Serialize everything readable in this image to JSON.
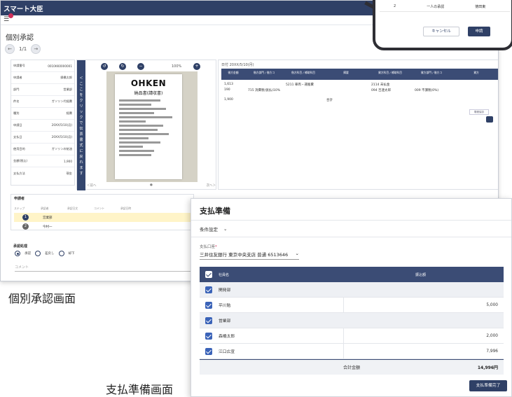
{
  "approval": {
    "app_title": "スマート大臣",
    "menu_icon": "menu-icon",
    "page_title": "個別承認",
    "pager": {
      "count": "1/1"
    },
    "info_rows": [
      {
        "label": "申請番号",
        "value": "0010KK0000001"
      },
      {
        "label": "申請者",
        "value": "操橋太郎"
      },
      {
        "label": "部門",
        "value": "営業部"
      },
      {
        "label": "件名",
        "value": "ガソリン代経費"
      },
      {
        "label": "種別",
        "value": "経費"
      },
      {
        "label": "申請日",
        "value": "20XX/5/10(月)"
      },
      {
        "label": "支払日",
        "value": "20XX/5/10(月)"
      },
      {
        "label": "使用目的",
        "value": "ガソリンの給油"
      },
      {
        "label": "金額(税込)",
        "value": "1,900"
      },
      {
        "label": "支払方法",
        "value": "現金"
      }
    ],
    "viewer": {
      "side_text": "ここをクリックで伝票書式に戻れます",
      "zoom": "100%",
      "receipt_logo": "OHKEN",
      "receipt_title": "納品書(請収書)",
      "prev": "＜前へ",
      "next": "次へ＞"
    },
    "detail": {
      "date": "日付 20XX/5/10(月)",
      "headers": [
        "借方金額",
        "借方部門 / 借方コ",
        "借方科目 / 補助科目",
        "摘要",
        "貸方科目 / 補助科目",
        "貸方部門 / 借方コ",
        "貸方"
      ],
      "rows": [
        {
          "a": "1,613",
          "b": "",
          "c": "5211 車両・運搬費",
          "d": "",
          "e": "2114 未払金",
          "f": ""
        },
        {
          "a": "190",
          "b": "715 消費税(仮払)10%",
          "c": "",
          "d": "",
          "e": "094 吉連太郎",
          "f": "009 不課税(0%)"
        },
        {
          "a": "1,900",
          "b": "",
          "c": "",
          "d": "合計",
          "e": "",
          "f": ""
        }
      ],
      "small_button": "電帳保存"
    },
    "flow": {
      "title": "申請者",
      "headers": [
        "ステップ",
        "承認者",
        "承認日文",
        "コメント",
        "承認日時"
      ],
      "steps": [
        {
          "num": "1",
          "name": "営業部"
        },
        {
          "num": "2",
          "name": "今村一"
        }
      ]
    },
    "decision": {
      "title": "承認処理",
      "options": [
        "承認",
        "差戻し",
        "却下"
      ],
      "selected": 0,
      "comment_placeholder": "コメント"
    },
    "caption": "個別承認画面"
  },
  "phone": {
    "row": {
      "num": "2",
      "label": "一人の承認",
      "name": "徳田東"
    },
    "cancel": "キャンセル",
    "apply": "申請"
  },
  "payment": {
    "title": "支払準備",
    "condition": "条件設定",
    "account_label": "支払口座",
    "account_required": "*",
    "account_value": "三井住友銀行 東京中央支店 普通 6513646",
    "table_header": {
      "name": "社員名",
      "amount": "振込額"
    },
    "rows": [
      {
        "name": "開発部",
        "amount": "",
        "group": true
      },
      {
        "name": "平川勉",
        "amount": "5,000",
        "group": false
      },
      {
        "name": "営業部",
        "amount": "",
        "group": true
      },
      {
        "name": "森橋太郎",
        "amount": "2,000",
        "group": false
      },
      {
        "name": "江口広宣",
        "amount": "7,996",
        "group": false
      }
    ],
    "total_label": "合計金額",
    "total_value": "14,996円",
    "done_button": "支払準備完了",
    "caption": "支払準備画面"
  }
}
